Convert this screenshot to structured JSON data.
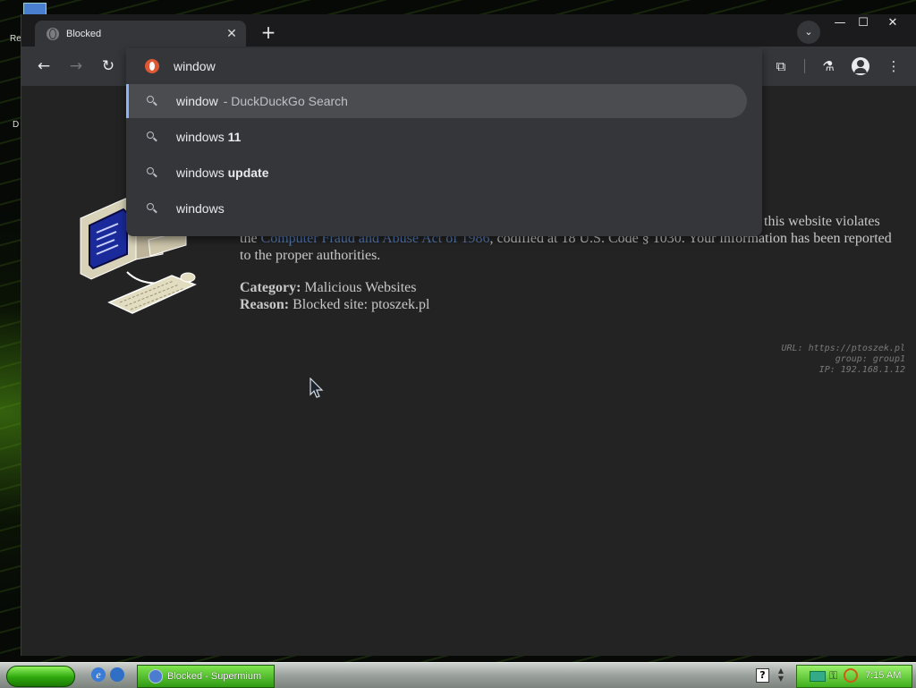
{
  "desktop": {
    "label_re": "Re",
    "label_d": "D"
  },
  "browser": {
    "tab": {
      "title": "Blocked",
      "close": "✕"
    },
    "new_tab": "+",
    "tab_search": "⌄",
    "window_controls": {
      "minimize": "—",
      "maximize": "☐",
      "close": "✕"
    },
    "nav": {
      "back": "←",
      "forward": "→",
      "reload": "↻"
    },
    "toolbar_icons": {
      "extensions": "⧉",
      "labs": "⚗",
      "menu": "⋮"
    },
    "omnibox": {
      "value": "window",
      "suggestions": [
        {
          "typed": "window",
          "rest": "",
          "sub": "- DuckDuckGo Search",
          "selected": true
        },
        {
          "typed": "windows",
          "rest": " 11",
          "sub": ""
        },
        {
          "typed": "windows",
          "rest": " update",
          "sub": ""
        },
        {
          "typed": "windows",
          "rest": "",
          "sub": ""
        }
      ]
    }
  },
  "page": {
    "line0": "this website violates",
    "para_prefix": "the ",
    "link": "Computer Fraud and Abuse Act of 1986",
    "para_suffix": ", codified at 18 U.S. Code § 1030. Your information has been reported to the proper authorities.",
    "category_label": "Category:",
    "category_value": " Malicious Websites",
    "reason_label": "Reason:",
    "reason_value": " Blocked site: ptoszek.pl",
    "meta": {
      "url": "URL: https://ptoszek.pl",
      "group": "group: group1",
      "ip": "IP: 192.168.1.12"
    }
  },
  "taskbar": {
    "task_label": "Blocked - Supermium",
    "help": "?",
    "clock": "7:15 AM",
    "ql_ie": "e"
  },
  "colors": {
    "link": "#5a7fb8",
    "selection_accent": "#8ab4f8",
    "taskbar_green": "#3fae1c",
    "ddg_orange": "#de5833"
  }
}
